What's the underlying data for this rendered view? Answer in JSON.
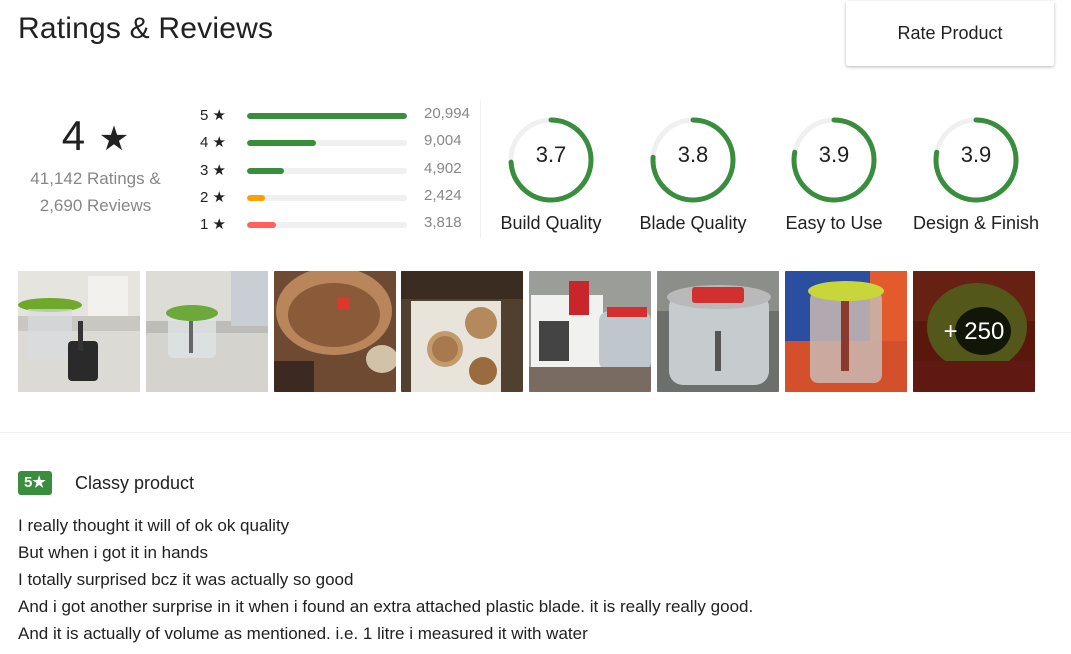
{
  "header": {
    "title": "Ratings & Reviews",
    "rate_button": "Rate Product"
  },
  "overall": {
    "rating": "4",
    "star": "★",
    "ratings_count": "41,142 Ratings &",
    "reviews_count": "2,690 Reviews"
  },
  "distribution": [
    {
      "label": "5 ★",
      "count": "20,994",
      "fraction": 1.0,
      "color": "#388e3c"
    },
    {
      "label": "4 ★",
      "count": "9,004",
      "fraction": 0.429,
      "color": "#388e3c"
    },
    {
      "label": "3 ★",
      "count": "4,902",
      "fraction": 0.233,
      "color": "#388e3c"
    },
    {
      "label": "2 ★",
      "count": "2,424",
      "fraction": 0.115,
      "color": "#ff9f00"
    },
    {
      "label": "1 ★",
      "count": "3,818",
      "fraction": 0.182,
      "color": "#ff6161"
    }
  ],
  "features": [
    {
      "value": "3.7",
      "name": "Build Quality",
      "fraction": 0.74
    },
    {
      "value": "3.8",
      "name": "Blade Quality",
      "fraction": 0.76
    },
    {
      "value": "3.9",
      "name": "Easy to Use",
      "fraction": 0.78
    },
    {
      "value": "3.9",
      "name": "Design & Finish",
      "fraction": 0.78
    }
  ],
  "colors": {
    "accent": "#388e3c",
    "orange": "#ff9f00",
    "red": "#ff6161",
    "muted": "#878787"
  },
  "photos": {
    "more_label": "+ 250",
    "count": 8
  },
  "review": {
    "rating_badge": "5★",
    "title": "Classy product",
    "lines": [
      "I really thought it will of ok ok quality",
      "But when i got it in hands",
      "I totally surprised bcz it was actually so good",
      "And i got another surprise in it when i found an extra attached plastic blade. it is really really good.",
      "And it is actually of volume as mentioned. i.e. 1 litre i measured it with water"
    ]
  }
}
